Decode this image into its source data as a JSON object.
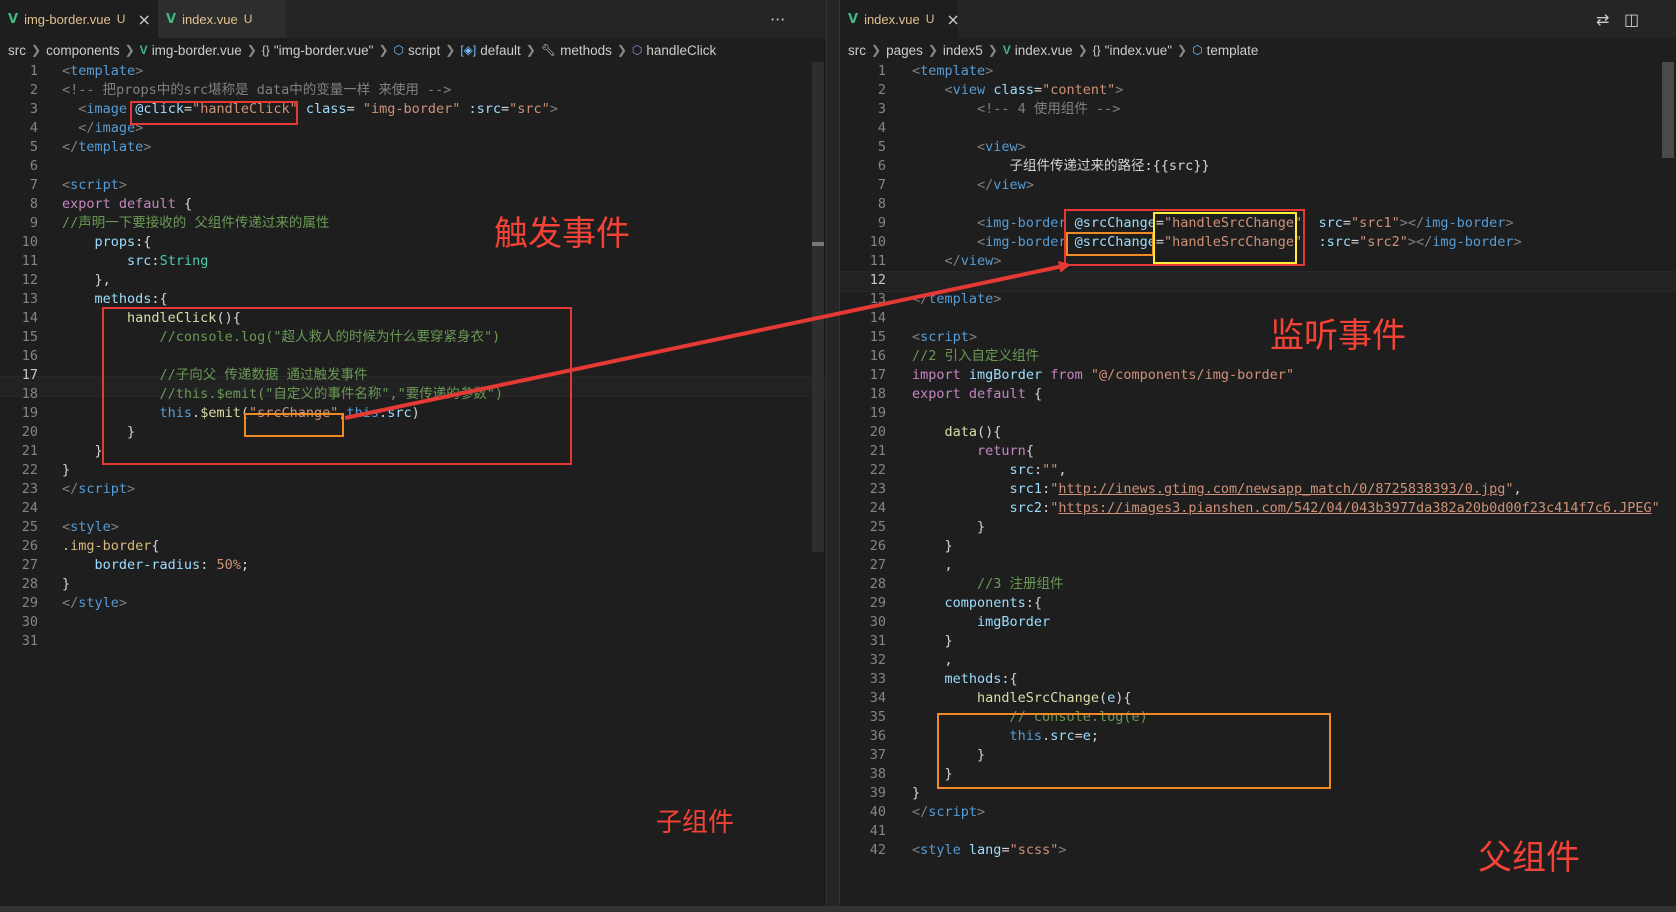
{
  "left": {
    "tabs": [
      {
        "name": "img-border.vue",
        "status": "U",
        "close": "×"
      },
      {
        "name": "index.vue",
        "status": "U"
      }
    ],
    "more_icon": "···",
    "breadcrumb": [
      "src",
      "components",
      "img-border.vue",
      "\"img-border.vue\"",
      "script",
      "default",
      "methods",
      "handleClick"
    ]
  },
  "right": {
    "tabs": [
      {
        "name": "index.vue",
        "status": "U",
        "close": "×"
      }
    ],
    "breadcrumb": [
      "src",
      "pages",
      "index5",
      "index.vue",
      "\"index.vue\"",
      "template"
    ],
    "current_line": 12
  },
  "annotations": {
    "trigger_event": "触发事件",
    "listen_event": "监听事件",
    "child_component": "子组件",
    "parent_component": "父组件"
  },
  "colors": {
    "annotation_red": "#e53935",
    "annotation_orange": "#f08a24",
    "annotation_yellow": "#ffeb3b",
    "vue_green": "#41b883"
  }
}
